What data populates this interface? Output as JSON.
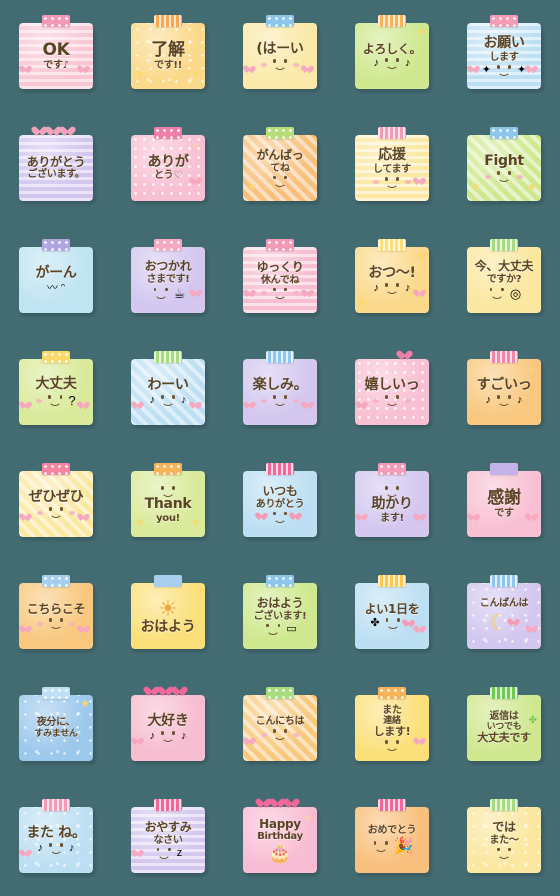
{
  "page": {
    "background_color": "#436b72",
    "columns": 5,
    "rows": 8,
    "total_stickers": 40
  },
  "stickers": [
    {
      "id": 1,
      "lines": [
        "OK",
        "です♪"
      ],
      "paper": "#f9c6d4",
      "tape": "#f298b8",
      "tape_style": "t-dot",
      "pattern": "pat-hstripe",
      "size": "s-xl",
      "face": "none",
      "deco": [
        "heart-left",
        "heart-right"
      ],
      "text_color": "#5b4426"
    },
    {
      "id": 2,
      "lines": [
        "了解",
        "です!!"
      ],
      "paper": "#fbd98a",
      "tape": "#f7a94f",
      "tape_style": "t-stripe",
      "pattern": "pat-sparkle",
      "size": "s-xl",
      "face": "none",
      "deco": [
        "star-left",
        "star-right"
      ],
      "text_color": "#5b4426"
    },
    {
      "id": 3,
      "lines": [
        "(はーい"
      ],
      "paper": "#fae9a8",
      "tape": "#8fc7ec",
      "tape_style": "t-dot",
      "pattern": "pat-plain",
      "size": "s-lg",
      "face": "smile-cheeks",
      "deco": [
        "heart-left",
        "heart-right"
      ],
      "text_color": "#5b4426"
    },
    {
      "id": 4,
      "lines": [
        "よろしく。"
      ],
      "paper": "#cfe88f",
      "tape": "#f7b25a",
      "tape_style": "t-stripe",
      "pattern": "pat-plain",
      "size": "s-md",
      "face": "smile-notes",
      "deco": [
        "star-tr"
      ],
      "text_color": "#5b4426"
    },
    {
      "id": 5,
      "lines": [
        "お願い",
        "します"
      ],
      "paper": "#bddff3",
      "tape": "#f59bb5",
      "tape_style": "t-dot",
      "pattern": "pat-hstripe",
      "size": "s-lg",
      "face": "smile-sparkle",
      "deco": [
        "heart-left",
        "heart-right"
      ],
      "text_color": "#5b4426"
    },
    {
      "id": 6,
      "lines": [
        "ありがとう",
        "ございます。"
      ],
      "paper": "#d2c6ef",
      "tape": "#f4a3bc",
      "tape_style": "hearts",
      "pattern": "pat-hstripe",
      "size": "s-md",
      "face": "none",
      "deco": [],
      "text_color": "#5b4426"
    },
    {
      "id": 7,
      "lines": [
        "ありが",
        "とう♡"
      ],
      "paper": "#f9c0d3",
      "tape": "#ef7fa8",
      "tape_style": "t-dot",
      "pattern": "pat-dot",
      "size": "s-lg",
      "face": "none",
      "deco": [
        "heart-right",
        "sparkle"
      ],
      "text_color": "#5b4426"
    },
    {
      "id": 8,
      "lines": [
        "がんばっ",
        "てね"
      ],
      "paper": "#f9bf7c",
      "tape": "#b9dd7a",
      "tape_style": "t-dot",
      "pattern": "pat-diag",
      "size": "s-md",
      "face": "smile-inline",
      "deco": [
        "star-left"
      ],
      "text_color": "#5b4426"
    },
    {
      "id": 9,
      "lines": [
        "応援",
        "してます"
      ],
      "paper": "#fbe79f",
      "tape": "#f49bb8",
      "tape_style": "t-stripe",
      "pattern": "pat-hstripe",
      "size": "s-lg",
      "face": "smile-cheeks",
      "deco": [
        "heart-right"
      ],
      "text_color": "#5b4426"
    },
    {
      "id": 10,
      "lines": [
        "Fight"
      ],
      "paper": "#cfe88f",
      "tape": "#8fc7ec",
      "tape_style": "t-dot",
      "pattern": "pat-diag",
      "size": "s-lg",
      "face": "smile-cheeks",
      "deco": [
        "star-left",
        "star-right"
      ],
      "text_color": "#5b4426"
    },
    {
      "id": 11,
      "lines": [
        "がーん"
      ],
      "paper": "#bfe4f2",
      "tape": "#b0a6e0",
      "tape_style": "t-dot",
      "pattern": "pat-plain",
      "size": "s-lg",
      "face": "sad",
      "deco": [],
      "text_color": "#5b4426"
    },
    {
      "id": 12,
      "lines": [
        "おつかれ",
        "さまです!"
      ],
      "paper": "#d3c7ef",
      "tape": "#f5a9c2",
      "tape_style": "t-dot",
      "pattern": "pat-plain",
      "size": "s-md",
      "face": "smile-cup",
      "deco": [
        "heart-right"
      ],
      "text_color": "#5b4426"
    },
    {
      "id": 13,
      "lines": [
        "ゆっくり",
        "休んでね"
      ],
      "paper": "#f7bdd0",
      "tape": "#f29ab6",
      "tape_style": "t-dot",
      "pattern": "pat-hstripe",
      "size": "s-md",
      "face": "smile-cheeks",
      "deco": [
        "heart-left",
        "heart-right"
      ],
      "text_color": "#5b4426"
    },
    {
      "id": 14,
      "lines": [
        "おつ〜!"
      ],
      "paper": "#fbd98a",
      "tape": "#fbe07a",
      "tape_style": "t-stripe",
      "pattern": "pat-plain",
      "size": "s-lg",
      "face": "smile-notes",
      "deco": [
        "star-tr",
        "star-bl",
        "heart-right"
      ],
      "text_color": "#5b4426"
    },
    {
      "id": 15,
      "lines": [
        "今、大丈夫",
        "ですか?"
      ],
      "paper": "#fbe79f",
      "tape": "#a9dc7e",
      "tape_style": "t-stripe",
      "pattern": "pat-plain",
      "size": "s-md",
      "face": "smile-clock",
      "deco": [
        "sparkle"
      ],
      "text_color": "#5b4426"
    },
    {
      "id": 16,
      "lines": [
        "大丈夫"
      ],
      "paper": "#d9ea9a",
      "tape": "#fbd96a",
      "tape_style": "t-dot",
      "pattern": "pat-plain",
      "size": "s-lg",
      "face": "smile-question",
      "deco": [
        "heart-left",
        "heart-right"
      ],
      "text_color": "#5b4426"
    },
    {
      "id": 17,
      "lines": [
        "わーい"
      ],
      "paper": "#bddff3",
      "tape": "#a9dc7e",
      "tape_style": "t-stripe",
      "pattern": "pat-diag",
      "size": "s-lg",
      "face": "smile-notes",
      "deco": [
        "heart-left",
        "heart-right"
      ],
      "text_color": "#5b4426"
    },
    {
      "id": 18,
      "lines": [
        "楽しみ。"
      ],
      "paper": "#d3c7ef",
      "tape": "#8fc7ec",
      "tape_style": "t-stripe",
      "pattern": "pat-plain",
      "size": "s-lg",
      "face": "smile-cheeks",
      "deco": [
        "heart-left",
        "heart-right"
      ],
      "text_color": "#5b4426"
    },
    {
      "id": 19,
      "lines": [
        "嬉しいっ"
      ],
      "paper": "#f9c0d3",
      "tape": "#ef7fa8",
      "tape_style": "heart-single",
      "pattern": "pat-dot",
      "size": "s-lg",
      "face": "smile-cheeks",
      "deco": [
        "heart-left"
      ],
      "text_color": "#5b4426"
    },
    {
      "id": 20,
      "lines": [
        "すごいっ"
      ],
      "paper": "#f9c87e",
      "tape": "#f286a8",
      "tape_style": "t-stripe",
      "pattern": "pat-plain",
      "size": "s-lg",
      "face": "smile-notes",
      "deco": [
        "sparkle"
      ],
      "text_color": "#5b4426"
    },
    {
      "id": 21,
      "lines": [
        "ぜひぜひ"
      ],
      "paper": "#fbe79f",
      "tape": "#f5849f",
      "tape_style": "t-dot",
      "pattern": "pat-diag",
      "size": "s-lg",
      "face": "smile-cheeks",
      "deco": [
        "heart-left",
        "heart-right"
      ],
      "text_color": "#5b4426"
    },
    {
      "id": 22,
      "lines": [
        "Thank",
        "you!"
      ],
      "paper": "#d9ea9a",
      "tape": "#f7b25a",
      "tape_style": "t-dot",
      "pattern": "pat-plain",
      "size": "s-lg",
      "face": "smile-top",
      "deco": [
        "star-left",
        "star-right"
      ],
      "text_color": "#5b4426"
    },
    {
      "id": 23,
      "lines": [
        "いつも",
        "ありがとう"
      ],
      "paper": "#bddff3",
      "tape": "#f2679a",
      "tape_style": "t-stripe",
      "pattern": "pat-plain",
      "size": "s-md",
      "face": "smile-hearts",
      "deco": [],
      "text_color": "#5b4426"
    },
    {
      "id": 24,
      "lines": [
        "助かり",
        "ます!"
      ],
      "paper": "#d3c7ef",
      "tape": "#f49bb8",
      "tape_style": "t-dot",
      "pattern": "pat-plain",
      "size": "s-lg",
      "face": "smile-top",
      "deco": [
        "heart-left",
        "heart-right"
      ],
      "text_color": "#5b4426"
    },
    {
      "id": 25,
      "lines": [
        "感謝",
        "です"
      ],
      "paper": "#f9c0d3",
      "tape": "#c3b4e8",
      "tape_style": "t-plain",
      "pattern": "pat-plain",
      "size": "s-xl",
      "face": "none",
      "deco": [
        "heart-left",
        "heart-right"
      ],
      "text_color": "#5b4426"
    },
    {
      "id": 26,
      "lines": [
        "こちらこそ"
      ],
      "paper": "#f9c87e",
      "tape": "#a8cfee",
      "tape_style": "t-dot",
      "pattern": "pat-plain",
      "size": "s-md",
      "face": "smile-cheeks",
      "deco": [
        "heart-left",
        "heart-right"
      ],
      "text_color": "#5b4426"
    },
    {
      "id": 27,
      "lines": [
        "おはよう"
      ],
      "paper": "#fbe07a",
      "tape": "#a8cfee",
      "tape_style": "t-plain",
      "pattern": "pat-plain",
      "size": "s-lg",
      "face": "sun",
      "deco": [
        "sparkle"
      ],
      "text_color": "#5b4426"
    },
    {
      "id": 28,
      "lines": [
        "おはよう",
        "ございます!"
      ],
      "paper": "#cfe88f",
      "tape": "#8fc7ec",
      "tape_style": "t-dot",
      "pattern": "pat-plain",
      "size": "s-md",
      "face": "smile-mug",
      "deco": [],
      "text_color": "#5b4426"
    },
    {
      "id": 29,
      "lines": [
        "よい1日を"
      ],
      "paper": "#bddff3",
      "tape": "#fbc94e",
      "tape_style": "t-stripe",
      "pattern": "pat-plain",
      "size": "s-md",
      "face": "smile-clover",
      "deco": [
        "heart-right"
      ],
      "text_color": "#5b4426"
    },
    {
      "id": 30,
      "lines": [
        "こんばんは"
      ],
      "paper": "#d3c7ef",
      "tape": "#8fc7ec",
      "tape_style": "t-stripe",
      "pattern": "pat-sparkle",
      "size": "s-sm",
      "face": "moon",
      "deco": [
        "heart-right"
      ],
      "text_color": "#5b4426"
    },
    {
      "id": 31,
      "lines": [
        "夜分に、",
        "すみません"
      ],
      "paper": "#9cc8ec",
      "tape": "#bfe0f4",
      "tape_style": "t-dot",
      "pattern": "pat-sparkle",
      "size": "s-sm",
      "face": "none",
      "deco": [
        "star-tr"
      ],
      "text_color": "#5b4426"
    },
    {
      "id": 32,
      "lines": [
        "大好き"
      ],
      "paper": "#f7bdd0",
      "tape": "#f2679a",
      "tape_style": "hearts",
      "pattern": "pat-plain",
      "size": "s-lg",
      "face": "smile-notes",
      "deco": [
        "heart-left"
      ],
      "text_color": "#5b4426"
    },
    {
      "id": 33,
      "lines": [
        "こんにちは"
      ],
      "paper": "#f9c87e",
      "tape": "#a9dc7e",
      "tape_style": "t-dot",
      "pattern": "pat-diag",
      "size": "s-sm",
      "face": "smile-cheeks",
      "deco": [
        "heart-left"
      ],
      "text_color": "#5b4426"
    },
    {
      "id": 34,
      "lines": [
        "また",
        "連絡",
        "します!"
      ],
      "paper": "#fbe07a",
      "tape": "#f7b25a",
      "tape_style": "t-dot",
      "pattern": "pat-plain",
      "size": "s-sm",
      "face": "smile-inline",
      "deco": [
        "heart-right"
      ],
      "text_color": "#5b4426"
    },
    {
      "id": 35,
      "lines": [
        "返信は",
        "いつでも",
        "大丈夫です"
      ],
      "paper": "#cfe88f",
      "tape": "#6fc94e",
      "tape_style": "t-stripe",
      "pattern": "pat-plain",
      "size": "s-sm",
      "face": "none",
      "deco": [
        "clover"
      ],
      "text_color": "#5b4426"
    },
    {
      "id": 36,
      "lines": [
        "また ね。"
      ],
      "paper": "#bddff3",
      "tape": "#f49bb8",
      "tape_style": "t-stripe",
      "pattern": "pat-sparkle",
      "size": "s-lg",
      "face": "smile-notes",
      "deco": [
        "heart-left"
      ],
      "text_color": "#5b4426"
    },
    {
      "id": 37,
      "lines": [
        "おやすみ",
        "なさい"
      ],
      "paper": "#d3c7ef",
      "tape": "#f2679a",
      "tape_style": "t-stripe",
      "pattern": "pat-hstripe",
      "size": "s-md",
      "face": "sleep",
      "deco": [
        "heart-left"
      ],
      "text_color": "#5b4426"
    },
    {
      "id": 38,
      "lines": [
        "Happy",
        "Birthday"
      ],
      "paper": "#f9bdd3",
      "tape": "#f2679a",
      "tape_style": "hearts",
      "pattern": "pat-plain",
      "size": "s-md",
      "face": "cake",
      "deco": [
        "sparkle"
      ],
      "text_color": "#5b4426"
    },
    {
      "id": 39,
      "lines": [
        "おめでとう"
      ],
      "paper": "#f9bf7c",
      "tape": "#f2679a",
      "tape_style": "t-stripe",
      "pattern": "pat-plain",
      "size": "s-sm",
      "face": "party",
      "deco": [],
      "text_color": "#5b4426"
    },
    {
      "id": 40,
      "lines": [
        "では",
        "また〜"
      ],
      "paper": "#fbe79f",
      "tape": "#a9dc7e",
      "tape_style": "t-stripe",
      "pattern": "pat-sparkle",
      "size": "s-md",
      "face": "smile-inline",
      "deco": [],
      "text_color": "#5b4426"
    }
  ]
}
